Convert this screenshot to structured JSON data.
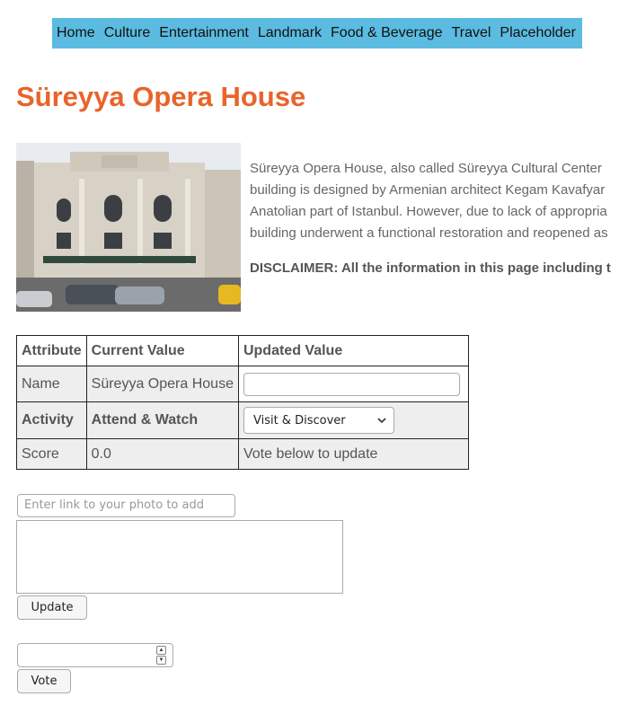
{
  "nav": {
    "items": [
      {
        "label": "Home"
      },
      {
        "label": "Culture"
      },
      {
        "label": "Entertainment"
      },
      {
        "label": "Landmark"
      },
      {
        "label": "Food & Beverage"
      },
      {
        "label": "Travel"
      },
      {
        "label": "Placeholder"
      }
    ]
  },
  "page": {
    "title": "Süreyya Opera House",
    "description": [
      "Süreyya Opera House, also called Süreyya Cultural Center",
      "building is designed by Armenian architect Kegam Kavafyar",
      "Anatolian part of Istanbul. However, due to lack of appropria",
      "building underwent a functional restoration and reopened as"
    ],
    "disclaimer": "DISCLAIMER: All the information in this page including t"
  },
  "table": {
    "headers": [
      "Attribute",
      "Current Value",
      "Updated Value"
    ],
    "rows": [
      {
        "attribute": "Name",
        "current": "Süreyya Opera House",
        "updated": ""
      },
      {
        "attribute": "Activity",
        "current": "Attend & Watch",
        "updated": "Visit & Discover"
      },
      {
        "attribute": "Score",
        "current": "0.0",
        "updated": "Vote below to update"
      }
    ]
  },
  "form": {
    "photo_link_placeholder": "Enter link to your photo to add",
    "comment_value": "",
    "update_label": "Update",
    "vote_value": "",
    "vote_label": "Vote"
  },
  "colors": {
    "nav_bg": "#5bbbe0",
    "title": "#e8642a",
    "row_shaded": "#eeeeee"
  },
  "icons": {
    "select_arrow": "chevron-down-icon",
    "spinner_up": "spin-up-icon",
    "spinner_down": "spin-down-icon",
    "textarea_resize": "resize-handle-icon"
  }
}
